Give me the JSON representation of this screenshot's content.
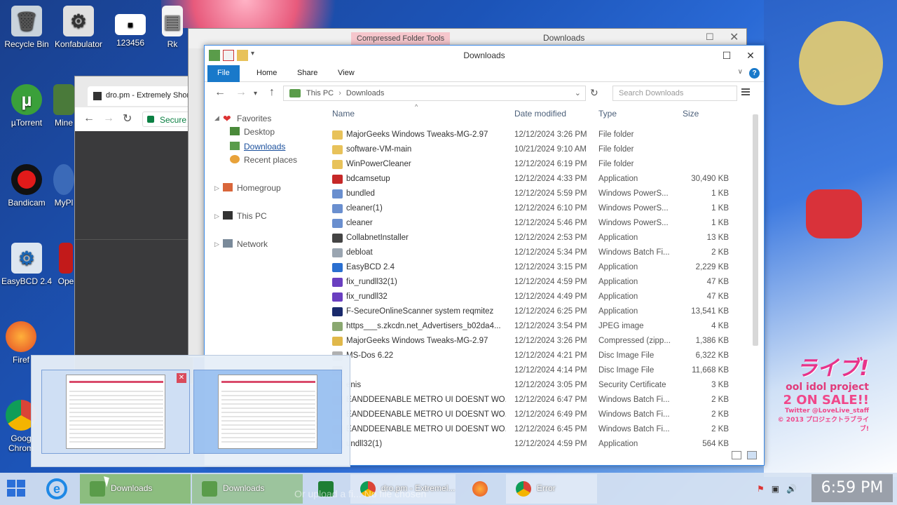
{
  "desktop": {
    "icons": [
      {
        "label": "Recycle Bin"
      },
      {
        "label": "Konfabulator"
      },
      {
        "label": "123456"
      },
      {
        "label": "Rk"
      },
      {
        "label": "µTorrent"
      },
      {
        "label": "Mine"
      },
      {
        "label": "Bandicam"
      },
      {
        "label": "MyPl"
      },
      {
        "label": "EasyBCD 2.4"
      },
      {
        "label": "Ope"
      },
      {
        "label": "Firef"
      },
      {
        "label": "Goog\nChrom"
      }
    ],
    "wallpaper_text": {
      "logo": "ライブ!",
      "subtitle": "ool idol project",
      "sale": "2 ON SALE!!",
      "twitter": "Twitter @LoveLive_staff",
      "copyright": "© 2013 プロジェクトラブライブ!"
    }
  },
  "chrome_bg": {
    "tab_title": "dro.pm - Extremely Short",
    "address": "Secure"
  },
  "explorer_back": {
    "context_tab": "Compressed Folder Tools",
    "title": "Downloads"
  },
  "explorer": {
    "title": "Downloads",
    "ribbon_tabs": [
      "File",
      "Home",
      "Share",
      "View"
    ],
    "breadcrumb": [
      "This PC",
      "Downloads"
    ],
    "search_placeholder": "Search Downloads",
    "nav": {
      "favorites": "Favorites",
      "desktop": "Desktop",
      "downloads": "Downloads",
      "recent": "Recent places",
      "homegroup": "Homegroup",
      "thispc": "This PC",
      "network": "Network"
    },
    "columns": {
      "name": "Name",
      "date": "Date modified",
      "type": "Type",
      "size": "Size"
    },
    "files": [
      {
        "name": "MajorGeeks Windows Tweaks-MG-2.97",
        "date": "12/12/2024 3:26 PM",
        "type": "File folder",
        "size": "",
        "icon": "folder"
      },
      {
        "name": "software-VM-main",
        "date": "10/21/2024 9:10 AM",
        "type": "File folder",
        "size": "",
        "icon": "folder"
      },
      {
        "name": "WinPowerCleaner",
        "date": "12/12/2024 6:19 PM",
        "type": "File folder",
        "size": "",
        "icon": "folder"
      },
      {
        "name": "bdcamsetup",
        "date": "12/12/2024 4:33 PM",
        "type": "Application",
        "size": "30,490 KB",
        "icon": "app-red"
      },
      {
        "name": "bundled",
        "date": "12/12/2024 5:59 PM",
        "type": "Windows PowerS...",
        "size": "1 KB",
        "icon": "script"
      },
      {
        "name": "cleaner(1)",
        "date": "12/12/2024 6:10 PM",
        "type": "Windows PowerS...",
        "size": "1 KB",
        "icon": "script"
      },
      {
        "name": "cleaner",
        "date": "12/12/2024 5:46 PM",
        "type": "Windows PowerS...",
        "size": "1 KB",
        "icon": "script"
      },
      {
        "name": "CollabnetInstaller",
        "date": "12/12/2024 2:53 PM",
        "type": "Application",
        "size": "13 KB",
        "icon": "gear"
      },
      {
        "name": "debloat",
        "date": "12/12/2024 5:34 PM",
        "type": "Windows Batch Fi...",
        "size": "2 KB",
        "icon": "batch"
      },
      {
        "name": "EasyBCD 2.4",
        "date": "12/12/2024 3:15 PM",
        "type": "Application",
        "size": "2,229 KB",
        "icon": "app-blue"
      },
      {
        "name": "fix_rundll32(1)",
        "date": "12/12/2024 4:59 PM",
        "type": "Application",
        "size": "47 KB",
        "icon": "app-purple"
      },
      {
        "name": "fix_rundll32",
        "date": "12/12/2024 4:49 PM",
        "type": "Application",
        "size": "47 KB",
        "icon": "app-purple"
      },
      {
        "name": "F-SecureOnlineScanner system reqmitez",
        "date": "12/12/2024 6:25 PM",
        "type": "Application",
        "size": "13,541 KB",
        "icon": "app-navy"
      },
      {
        "name": "https___s.zkcdn.net_Advertisers_b02da4...",
        "date": "12/12/2024 3:54 PM",
        "type": "JPEG image",
        "size": "4 KB",
        "icon": "image"
      },
      {
        "name": "MajorGeeks Windows Tweaks-MG-2.97",
        "date": "12/12/2024 3:26 PM",
        "type": "Compressed (zipp...",
        "size": "1,386 KB",
        "icon": "zip"
      },
      {
        "name": "MS-Dos 6.22",
        "date": "12/12/2024 4:21 PM",
        "type": "Disc Image File",
        "size": "6,322 KB",
        "icon": "disc"
      },
      {
        "name": "",
        "date": "12/12/2024 4:14 PM",
        "type": "Disc Image File",
        "size": "11,668 KB",
        "icon": "disc"
      },
      {
        "name": "enis",
        "date": "12/12/2024 3:05 PM",
        "type": "Security Certificate",
        "size": "3 KB",
        "icon": "cert"
      },
      {
        "name": "EANDDEENABLE METRO UI DOESNT WO...",
        "date": "12/12/2024 6:47 PM",
        "type": "Windows Batch Fi...",
        "size": "2 KB",
        "icon": "batch"
      },
      {
        "name": "EANDDEENABLE METRO UI DOESNT WO...",
        "date": "12/12/2024 6:49 PM",
        "type": "Windows Batch Fi...",
        "size": "2 KB",
        "icon": "batch"
      },
      {
        "name": "EANDDEENABLE METRO UI DOESNT WO...",
        "date": "12/12/2024 6:45 PM",
        "type": "Windows Batch Fi...",
        "size": "2 KB",
        "icon": "batch"
      },
      {
        "name": "undll32(1)",
        "date": "12/12/2024 4:59 PM",
        "type": "Application",
        "size": "564 KB",
        "icon": "app-purple"
      }
    ]
  },
  "taskbar": {
    "items": [
      {
        "label": "Downloads"
      },
      {
        "label": "Downloads"
      },
      {
        "label": "dro.pm - Extremel..."
      },
      {
        "label": "Error"
      }
    ],
    "overlay_text": "Or upload a fi...         No file chosen",
    "clock": "6:59 PM"
  },
  "colors": {
    "accent": "#1979ca",
    "context_tab": "#f6c6cc",
    "folder": "#e8c25a"
  }
}
